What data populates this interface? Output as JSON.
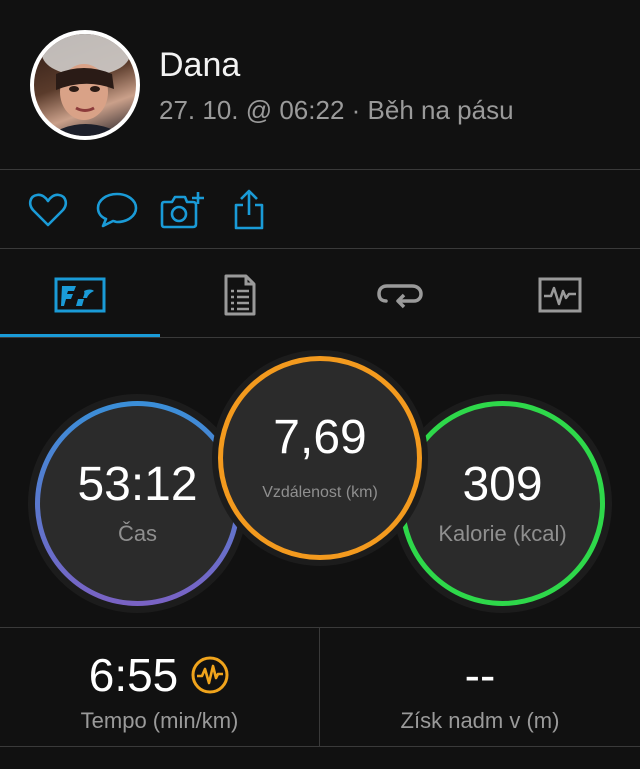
{
  "header": {
    "user_name": "Dana",
    "meta": "27. 10. @ 06:22 · Běh na pásu"
  },
  "actions": {
    "icons": [
      "heart-icon",
      "comment-icon",
      "add-photo-icon",
      "share-icon"
    ]
  },
  "tabs": {
    "items": [
      "stats-tab",
      "details-tab",
      "laps-tab",
      "charts-tab"
    ],
    "active_index": 0
  },
  "circles": {
    "time": {
      "value": "53:12",
      "label": "Čas"
    },
    "distance": {
      "value": "7,69",
      "label": "Vzdálenost (km)"
    },
    "calories": {
      "value": "309",
      "label": "Kalorie (kcal)"
    }
  },
  "stats": {
    "pace": {
      "value": "6:55",
      "label": "Tempo (min/km)"
    },
    "elevation": {
      "value": "--",
      "label": "Získ nadm v (m)"
    }
  },
  "colors": {
    "accent": "#1a9bd7",
    "time_ring_top": "#3a8fd8",
    "time_ring_bottom": "#7a62c4",
    "distance_ring": "#f39a1e",
    "calories_ring": "#2ed84a",
    "pace_icon": "#f0a41c"
  }
}
